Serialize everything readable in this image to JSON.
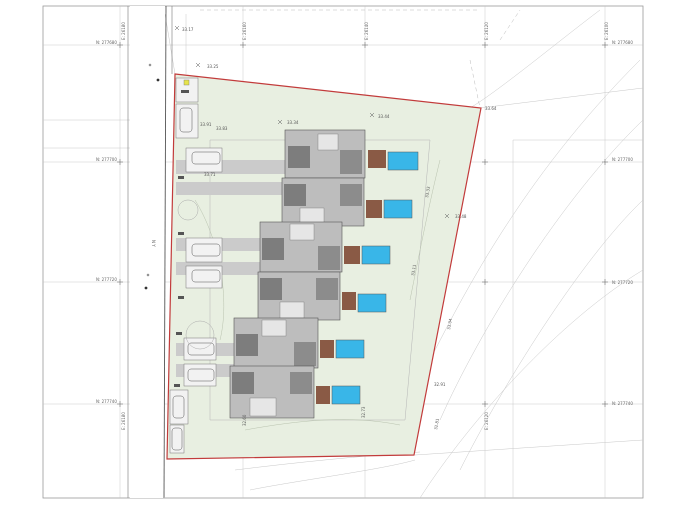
{
  "grid": {
    "north_labels": [
      "N: 277680",
      "N: 277700",
      "N: 277720",
      "N: 277740"
    ],
    "east_labels": [
      "E: 26180",
      "E: 26160",
      "E: 26140",
      "E: 26120",
      "E: 26100"
    ]
  },
  "road": {
    "label": "N Y"
  },
  "spot_levels": [
    "33.17",
    "33.25",
    "33.34",
    "33.44",
    "33.64",
    "33.91",
    "33.83",
    "33.71",
    "33.48",
    "33.33",
    "33.11",
    "33.04",
    "32.91",
    "32.81",
    "32.73",
    "32.60"
  ],
  "colors": {
    "site_fill": "#e8efe1",
    "boundary": "#c23b3b",
    "pool": "#39b6e8",
    "deck": "#8a5a45",
    "building": "#9a9a9a",
    "drive": "#c9c9c9"
  }
}
